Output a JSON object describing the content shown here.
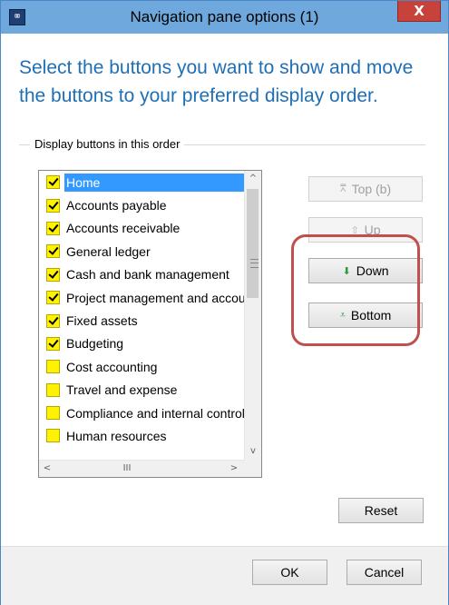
{
  "window": {
    "title": "Navigation pane options (1)",
    "app_icon_glyph": "⌧",
    "close_glyph": "X"
  },
  "instruction": "Select the buttons you want to show and move the buttons to your preferred display order.",
  "group_label": "Display buttons in this order",
  "list": {
    "items": [
      {
        "label": "Home",
        "checked": true,
        "selected": true
      },
      {
        "label": "Accounts payable",
        "checked": true
      },
      {
        "label": "Accounts receivable",
        "checked": true
      },
      {
        "label": "General ledger",
        "checked": true
      },
      {
        "label": "Cash and bank management",
        "checked": true
      },
      {
        "label": "Project management and accounting",
        "checked": true
      },
      {
        "label": "Fixed assets",
        "checked": true
      },
      {
        "label": "Budgeting",
        "checked": true
      },
      {
        "label": "Cost accounting",
        "checked": false
      },
      {
        "label": "Travel and expense",
        "checked": false
      },
      {
        "label": "Compliance and internal controls",
        "checked": false
      },
      {
        "label": "Human resources",
        "checked": false
      }
    ],
    "scroll_up_glyph": "^",
    "scroll_down_glyph": "v",
    "scroll_left_glyph": "<",
    "scroll_right_glyph": ">",
    "hscroll_grip": "III"
  },
  "buttons": {
    "top": {
      "label": "Top (b)",
      "icon": "move-top-icon",
      "glyph": "⩞",
      "enabled": false
    },
    "up": {
      "label": "Up",
      "icon": "arrow-up-icon",
      "glyph": "⇧",
      "enabled": false
    },
    "down": {
      "label": "Down",
      "icon": "arrow-down-icon",
      "glyph": "⬇",
      "enabled": true
    },
    "bottom": {
      "label": "Bottom",
      "icon": "move-bottom-icon",
      "glyph": "⩡",
      "enabled": true
    },
    "reset": {
      "label": "Reset"
    },
    "ok": {
      "label": "OK"
    },
    "cancel": {
      "label": "Cancel"
    }
  },
  "colors": {
    "titlebar": "#6fa8dc",
    "instruction_text": "#1f6fb5",
    "checkbox_fill": "#fff200",
    "selection": "#3399ff",
    "highlight_ring": "#c0504d",
    "close_button": "#c6423a"
  }
}
